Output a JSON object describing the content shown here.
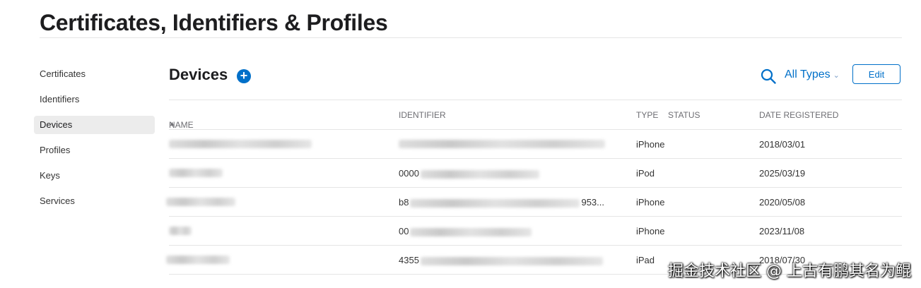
{
  "header": {
    "title": "Certificates, Identifiers & Profiles"
  },
  "sidebar": {
    "items": [
      {
        "label": "Certificates"
      },
      {
        "label": "Identifiers"
      },
      {
        "label": "Devices"
      },
      {
        "label": "Profiles"
      },
      {
        "label": "Keys"
      },
      {
        "label": "Services"
      }
    ],
    "active": "Devices"
  },
  "main": {
    "title": "Devices",
    "add_label": "+",
    "filter_label": "All Types",
    "edit_label": "Edit",
    "columns": {
      "name": "NAME",
      "identifier": "IDENTIFIER",
      "type": "TYPE",
      "status": "STATUS",
      "date": "DATE REGISTERED"
    },
    "rows": [
      {
        "id_visible": "",
        "id_tail": "",
        "type": "iPhone",
        "date": "2018/03/01"
      },
      {
        "id_visible": "0000",
        "id_tail": "",
        "type": "iPod",
        "date": "2025/03/19"
      },
      {
        "id_visible": "b8",
        "id_tail": "953...",
        "type": "iPhone",
        "date": "2020/05/08"
      },
      {
        "id_visible": "00",
        "id_tail": "",
        "type": "iPhone",
        "date": "2023/11/08"
      },
      {
        "id_visible": "4355",
        "id_tail": "",
        "type": "iPad",
        "date": "2018/07/30"
      }
    ]
  },
  "watermark": "掘金技术社区 @ 上古有鹏其名为鲲",
  "colors": {
    "accent": "#0070c9",
    "text": "#1d1d1f",
    "muted": "#6e6e73",
    "divider": "#e5e5e5"
  },
  "icons": {
    "search": "search-icon",
    "sort": "sort-ascending-icon",
    "add": "add-circle-icon",
    "chevron": "chevron-down-icon"
  }
}
